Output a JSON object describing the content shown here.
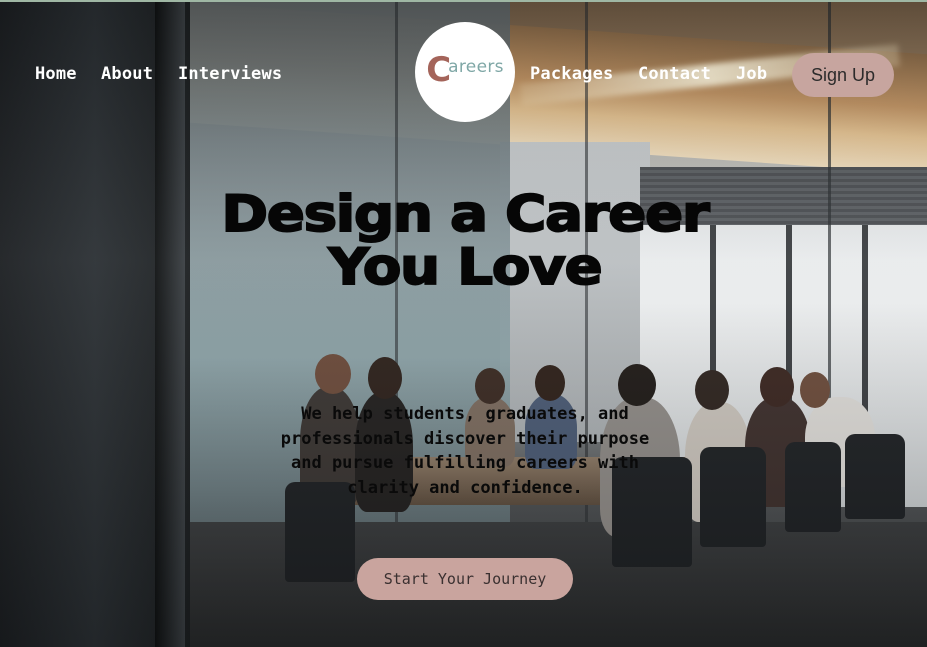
{
  "nav": {
    "left_links": [
      {
        "label": "Home"
      },
      {
        "label": "About"
      },
      {
        "label": "Interviews"
      }
    ],
    "right_links": [
      {
        "label": "Packages"
      },
      {
        "label": "Contact"
      },
      {
        "label": "Job"
      }
    ],
    "signup_label": "Sign Up"
  },
  "logo": {
    "initial": "C",
    "rest": "areers"
  },
  "hero": {
    "title": "Design a Career You Love",
    "subtitle": "We help students, graduates, and professionals discover their purpose and pursue fulfilling careers with clarity and confidence.",
    "cta_label": "Start Your Journey"
  },
  "colors": {
    "accent": "#c9a49e",
    "logo_c": "#a4645a",
    "logo_text": "#7fa7a6"
  }
}
